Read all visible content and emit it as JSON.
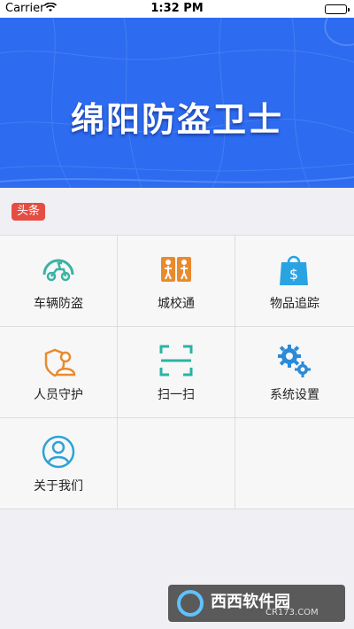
{
  "status_bar": {
    "carrier": "Carrier",
    "time": "1:32 PM"
  },
  "banner": {
    "title": "绵阳防盗卫士"
  },
  "headline": {
    "badge": "头条"
  },
  "menu": {
    "items": [
      {
        "label": "车辆防盗",
        "icon": "scooter-icon",
        "color": "#3ab3a3"
      },
      {
        "label": "城校通",
        "icon": "children-crossing-icon",
        "color": "#e98a2e"
      },
      {
        "label": "物品追踪",
        "icon": "shopping-bag-dollar-icon",
        "color": "#2aa3e3"
      },
      {
        "label": "人员守护",
        "icon": "person-shield-icon",
        "color": "#e98a2e"
      },
      {
        "label": "扫一扫",
        "icon": "scan-icon",
        "color": "#2ab3a3"
      },
      {
        "label": "系统设置",
        "icon": "gears-icon",
        "color": "#2a8ad8"
      },
      {
        "label": "关于我们",
        "icon": "user-circle-icon",
        "color": "#2aa3d8"
      }
    ]
  },
  "watermark": {
    "text": "西西软件园",
    "sub": "CR173.COM"
  },
  "colors": {
    "banner_blue": "#2d6bf0",
    "badge_red": "#e54d42"
  }
}
